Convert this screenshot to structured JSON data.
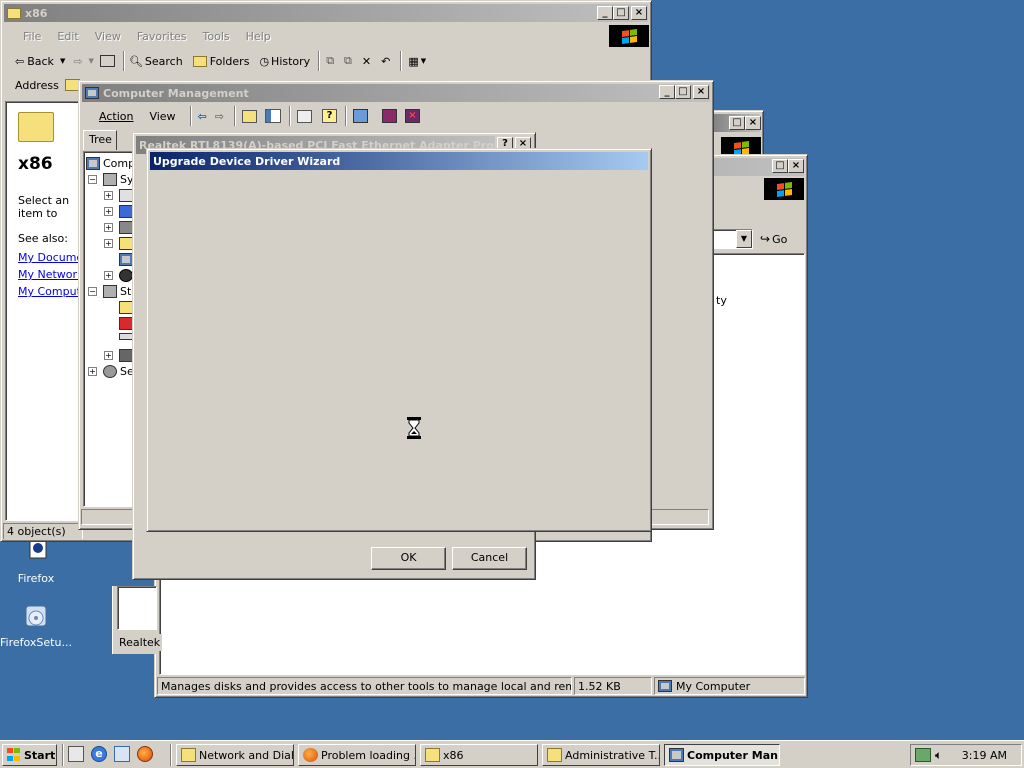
{
  "desktop": {
    "icons": [
      {
        "label": "Firefox"
      },
      {
        "label": "FirefoxSetu..."
      }
    ]
  },
  "explorer": {
    "title": "x86",
    "menu": [
      "File",
      "Edit",
      "View",
      "Favorites",
      "Tools",
      "Help"
    ],
    "toolbar": {
      "back": "Back",
      "search": "Search",
      "folders": "Folders",
      "history": "History"
    },
    "address_label": "Address",
    "folder_name": "x86",
    "desc": "Select an item to view its description.",
    "see_also": "See also:",
    "links": [
      "My Documents",
      "My Network Places",
      "My Computer"
    ],
    "status": "4 object(s)"
  },
  "background_explorer": {
    "go_label": "Go",
    "side_text": "ty",
    "status": {
      "text": "Manages disks and provides access to other tools to manage local and remote computers.",
      "size": "1.52 KB",
      "zone": "My Computer"
    },
    "tab_label": "Realtek"
  },
  "computer_management": {
    "title": "Computer Management",
    "menu": [
      "Action",
      "View"
    ],
    "tree_tab": "Tree",
    "tree": {
      "root": "Computer Management (Local)",
      "system_tools": "System Tools",
      "storage": "Storage",
      "services": "Services and Applications"
    }
  },
  "properties_dialog": {
    "title": "Realtek RTL8139(A)-based PCI Fast Ethernet Adapter Properties",
    "ok_label": "OK",
    "cancel_label": "Cancel"
  },
  "wizard": {
    "title": "Upgrade Device Driver Wizard"
  },
  "taskbar": {
    "start_label": "Start",
    "tasks": [
      {
        "label": "Network and Dial..."
      },
      {
        "label": "Problem loading ..."
      },
      {
        "label": "x86"
      },
      {
        "label": "Administrative T..."
      },
      {
        "label": "Computer Man..."
      }
    ],
    "clock": "3:19 AM"
  },
  "colors": {
    "desktop": "#3a6ea5",
    "active_title_start": "#0a246a",
    "active_title_end": "#a6caf0",
    "inactive_title_start": "#808080",
    "inactive_title_end": "#c0c0c0",
    "face": "#d4d0c8"
  }
}
